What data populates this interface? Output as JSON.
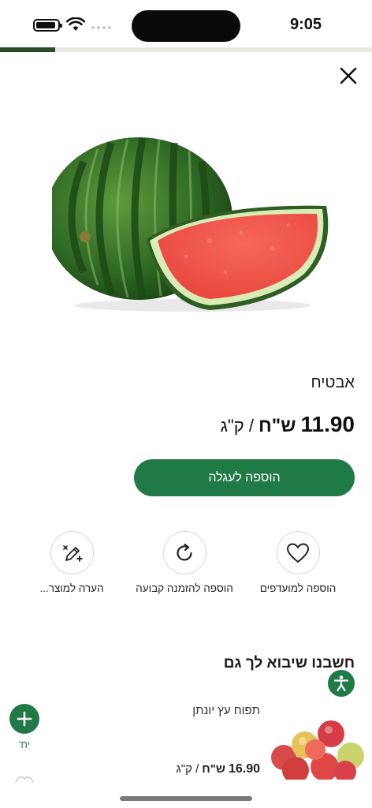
{
  "status_bar": {
    "time": "9:05"
  },
  "product": {
    "name": "אבטיח",
    "price": "11.90",
    "currency": "ש\"ח",
    "unit": "/ ק\"ג",
    "add_to_cart_label": "הוספה לעגלה"
  },
  "actions": [
    {
      "label": "הוספה למועדפים",
      "icon": "heart-icon"
    },
    {
      "label": "הוספה להזמנה קבועה",
      "icon": "refresh-icon"
    },
    {
      "label": "הערה למוצר...",
      "icon": "edit-note-icon"
    }
  ],
  "recommendations": {
    "title": "חשבנו שיבוא לך גם",
    "items": [
      {
        "name": "תפוח עץ יונתן",
        "price": "16.90",
        "currency": "ש\"ח",
        "unit": "/ ק\"ג",
        "unit_label": "יח'"
      }
    ]
  },
  "colors": {
    "brand_green": "#1f7a46"
  }
}
